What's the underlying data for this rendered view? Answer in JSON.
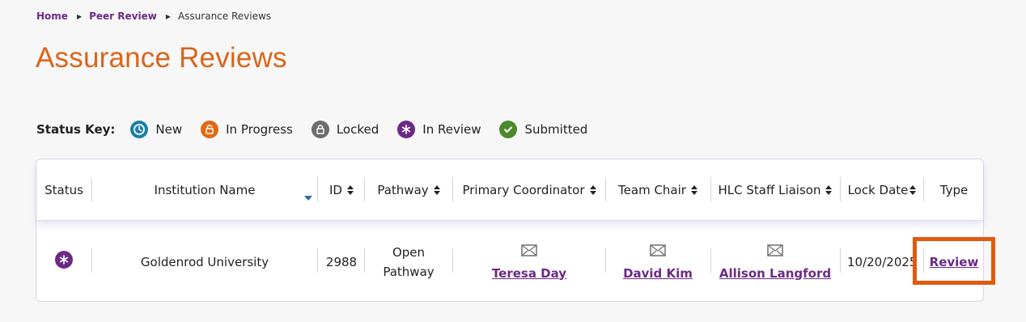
{
  "breadcrumb": {
    "home": "Home",
    "peer_review": "Peer Review",
    "current": "Assurance Reviews"
  },
  "page_title": "Assurance Reviews",
  "status_key": {
    "label": "Status Key:",
    "items": [
      {
        "label": "New",
        "icon": "clock-icon",
        "color": "#1a7fa8"
      },
      {
        "label": "In Progress",
        "icon": "lock-open-icon",
        "color": "#e06a14"
      },
      {
        "label": "Locked",
        "icon": "lock-icon",
        "color": "#6d6d6d"
      },
      {
        "label": "In Review",
        "icon": "asterisk-icon",
        "color": "#6b2a86"
      },
      {
        "label": "Submitted",
        "icon": "check-icon",
        "color": "#4a8a2c"
      }
    ]
  },
  "table": {
    "headers": {
      "status": "Status",
      "institution": "Institution Name",
      "id": "ID",
      "pathway": "Pathway",
      "coordinator": "Primary Coordinator",
      "chair": "Team Chair",
      "liaison": "HLC Staff Liaison",
      "lock_date": "Lock Date",
      "type": "Type"
    },
    "rows": [
      {
        "status_icon": "asterisk-icon",
        "institution": "Goldenrod University",
        "id": "2988",
        "pathway_line1": "Open",
        "pathway_line2": "Pathway",
        "coordinator": "Teresa Day",
        "chair": "David Kim",
        "liaison": "Allison Langford",
        "lock_date": "10/20/2025",
        "type_link": "Review"
      }
    ]
  },
  "colors": {
    "brand_purple": "#6b2a86",
    "title_orange": "#db6517",
    "highlight": "#e05a10"
  }
}
